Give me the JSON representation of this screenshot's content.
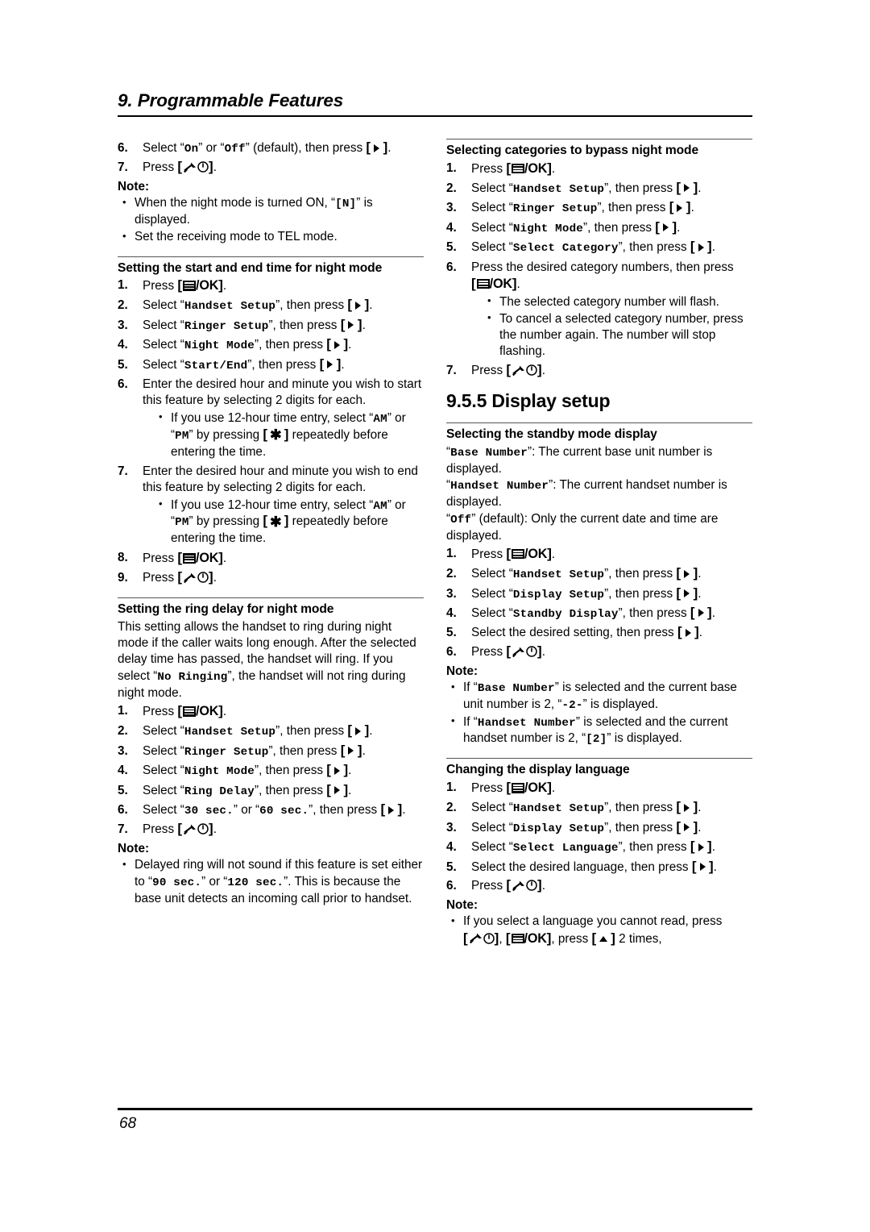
{
  "header": {
    "chapter_title": "9. Programmable Features"
  },
  "footer": {
    "page_number": "68"
  },
  "icons": {
    "menu_ok": "menu-ok-key-icon",
    "right_arrow": "right-arrow-key-icon",
    "up_arrow": "up-arrow-key-icon",
    "off_power": "off-power-key-icon",
    "asterisk": "asterisk-key-icon"
  },
  "left_column": {
    "cont_steps": {
      "step6": {
        "num": "6.",
        "t1": "Select “",
        "v1": "On",
        "t2": "” or “",
        "v2": "Off",
        "t3": "” (default), then press"
      },
      "step7": {
        "num": "7.",
        "t1": "Press"
      }
    },
    "cont_note": {
      "label": "Note:",
      "bullets": [
        {
          "t1": "When the night mode is turned ON, “",
          "v1": "[N]",
          "t2": "” is displayed."
        },
        {
          "t1": "Set the receiving mode to TEL mode."
        }
      ]
    },
    "sec_start_end": {
      "heading": "Setting the start and end time for night mode",
      "steps": [
        {
          "num": "1.",
          "t1": "Press"
        },
        {
          "num": "2.",
          "t1": "Select “",
          "v1": "Handset Setup",
          "t2": "”, then press"
        },
        {
          "num": "3.",
          "t1": "Select “",
          "v1": "Ringer Setup",
          "t2": "”, then press"
        },
        {
          "num": "4.",
          "t1": "Select “",
          "v1": "Night Mode",
          "t2": "”, then press"
        },
        {
          "num": "5.",
          "t1": "Select “",
          "v1": "Start/End",
          "t2": "”, then press"
        }
      ],
      "step6": {
        "num": "6.",
        "text": "Enter the desired hour and minute you wish to start this feature by selecting 2 digits for each.",
        "bullet": {
          "t1": "If you use 12-hour time entry, select “",
          "v1": "AM",
          "t2": "” or “",
          "v2": "PM",
          "t3": "” by pressing",
          "t4": "repeatedly before entering the time."
        }
      },
      "step7": {
        "num": "7.",
        "text": "Enter the desired hour and minute you wish to end this feature by selecting 2 digits for each.",
        "bullet": {
          "t1": "If you use 12-hour time entry, select “",
          "v1": "AM",
          "t2": "” or “",
          "v2": "PM",
          "t3": "” by pressing",
          "t4": "repeatedly before entering the time."
        }
      },
      "step8": {
        "num": "8.",
        "t1": "Press"
      },
      "step9": {
        "num": "9.",
        "t1": "Press"
      }
    },
    "sec_ring_delay": {
      "heading": "Setting the ring delay for night mode",
      "intro": {
        "t1": "This setting allows the handset to ring during night mode if the caller waits long enough. After the selected delay time has passed, the handset will ring. If you select “",
        "v1": "No Ringing",
        "t2": "”, the handset will not ring during night mode."
      },
      "steps": [
        {
          "num": "1.",
          "t1": "Press"
        },
        {
          "num": "2.",
          "t1": "Select “",
          "v1": "Handset Setup",
          "t2": "”, then press"
        },
        {
          "num": "3.",
          "t1": "Select “",
          "v1": "Ringer Setup",
          "t2": "”, then press"
        },
        {
          "num": "4.",
          "t1": "Select “",
          "v1": "Night Mode",
          "t2": "”, then press"
        },
        {
          "num": "5.",
          "t1": "Select “",
          "v1": "Ring Delay",
          "t2": "”, then press"
        }
      ],
      "step6": {
        "num": "6.",
        "t1": "Select “",
        "v1": "30 sec.",
        "t2": "” or “",
        "v2": "60 sec.",
        "t3": "”, then press"
      },
      "step7": {
        "num": "7.",
        "t1": "Press"
      },
      "note": {
        "label": "Note:",
        "bullet": {
          "t1": "Delayed ring will not sound if this feature is set either to “",
          "v1": "90 sec.",
          "t2": "” or “",
          "v2": "120 sec.",
          "t3": "”. This is because the base unit detects an incoming call prior to handset."
        }
      }
    }
  },
  "right_column": {
    "sec_bypass": {
      "heading": "Selecting categories to bypass night mode",
      "steps": [
        {
          "num": "1.",
          "t1": "Press"
        },
        {
          "num": "2.",
          "t1": "Select “",
          "v1": "Handset Setup",
          "t2": "”, then press"
        },
        {
          "num": "3.",
          "t1": "Select “",
          "v1": "Ringer Setup",
          "t2": "”, then press"
        },
        {
          "num": "4.",
          "t1": "Select “",
          "v1": "Night Mode",
          "t2": "”, then press"
        },
        {
          "num": "5.",
          "t1": "Select “",
          "v1": "Select Category",
          "t2": "”, then press"
        }
      ],
      "step6": {
        "num": "6.",
        "t1": "Press the desired category numbers, then press",
        "bullets": [
          {
            "t1": "The selected category number will flash."
          },
          {
            "t1": "To cancel a selected category number, press the number again. The number will stop flashing."
          }
        ]
      },
      "step7": {
        "num": "7.",
        "t1": "Press"
      }
    },
    "section_display": {
      "number_title": "9.5.5 Display setup"
    },
    "sec_standby": {
      "heading": "Selecting the standby mode display",
      "defs": [
        {
          "q_open": "“",
          "v": "Base Number",
          "q_close": "”",
          "t": ": The current base unit number is displayed."
        },
        {
          "q_open": "“",
          "v": "Handset Number",
          "q_close": "”",
          "t": ": The current handset number is displayed."
        },
        {
          "q_open": "“",
          "v": "Off",
          "q_close": "”",
          "t": " (default): Only the current date and time are displayed."
        }
      ],
      "steps": [
        {
          "num": "1.",
          "t1": "Press"
        },
        {
          "num": "2.",
          "t1": "Select “",
          "v1": "Handset Setup",
          "t2": "”, then press"
        },
        {
          "num": "3.",
          "t1": "Select “",
          "v1": "Display Setup",
          "t2": "”, then press"
        },
        {
          "num": "4.",
          "t1": "Select “",
          "v1": "Standby Display",
          "t2": "”, then press"
        },
        {
          "num": "5.",
          "t1": "Select the desired setting, then press"
        },
        {
          "num": "6.",
          "t1": "Press"
        }
      ],
      "note": {
        "label": "Note:",
        "bullets": [
          {
            "t1": "If “",
            "v1": "Base Number",
            "t2": "” is selected and the current base unit number is 2, “",
            "v2": "-2-",
            "t3": "” is displayed."
          },
          {
            "t1": "If “",
            "v1": "Handset Number",
            "t2": "” is selected and the current handset number is 2, “",
            "v2": "[2]",
            "t3": "” is displayed."
          }
        ]
      }
    },
    "sec_language": {
      "heading": "Changing the display language",
      "steps": [
        {
          "num": "1.",
          "t1": "Press"
        },
        {
          "num": "2.",
          "t1": "Select “",
          "v1": "Handset Setup",
          "t2": "”, then press"
        },
        {
          "num": "3.",
          "t1": "Select “",
          "v1": "Display Setup",
          "t2": "”, then press"
        },
        {
          "num": "4.",
          "t1": "Select “",
          "v1": "Select Language",
          "t2": "”, then press"
        },
        {
          "num": "5.",
          "t1": "Select the desired language, then press"
        },
        {
          "num": "6.",
          "t1": "Press"
        }
      ],
      "note": {
        "label": "Note:",
        "bullet": {
          "t1": "If you select a language you cannot read, press",
          "t2": ",",
          "t3": ", press",
          "t4": "2 times,"
        }
      }
    }
  }
}
